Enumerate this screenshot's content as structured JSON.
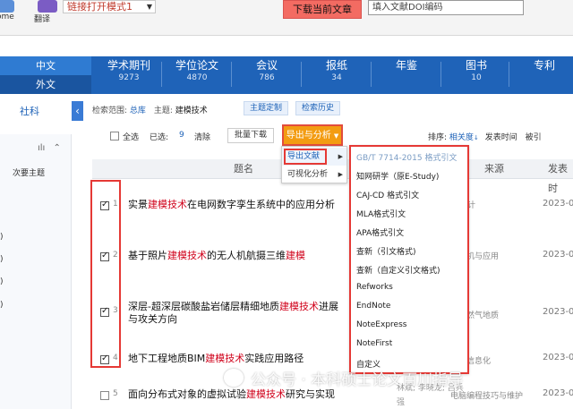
{
  "toolbar": {
    "buttons": [
      {
        "label": "ome",
        "icon": "home-icon"
      },
      {
        "label": "翻译",
        "icon": "translate-icon"
      }
    ],
    "link_mode": "链接打开模式1",
    "download_label": "下载当前文章",
    "doi_placeholder": "填入文献DOI编码"
  },
  "categories": {
    "languages": [
      "中文",
      "外文"
    ],
    "items": [
      {
        "name": "学术期刊",
        "count": "9273"
      },
      {
        "name": "学位论文",
        "count": "4870"
      },
      {
        "name": "会议",
        "count": "786"
      },
      {
        "name": "报纸",
        "count": "34"
      },
      {
        "name": "年鉴",
        "count": ""
      },
      {
        "name": "图书",
        "count": "10"
      },
      {
        "name": "专利",
        "count": ""
      }
    ]
  },
  "sidebar": {
    "tab": "社科",
    "secondary_topic": "次要主题",
    "marks": [
      ")",
      ")",
      ")",
      ")"
    ]
  },
  "search_meta": {
    "scope_label": "检索范围:",
    "scope": "总库",
    "topic_label": "主题:",
    "topic": "建模技术",
    "custom_label": "主题定制",
    "history_label": "检索历史"
  },
  "list_toolbar": {
    "select_all": "全选",
    "selected_label": "已选:",
    "selected_count": "9",
    "clear": "清除",
    "batch_download": "批量下载",
    "export_analyze": "导出与分析",
    "sort_label": "排序:",
    "sort_options": [
      "相关度",
      "发表时间",
      "被引"
    ]
  },
  "table": {
    "headers": [
      "题名",
      "来源",
      "发表时"
    ],
    "rows": [
      {
        "num": "1",
        "checked": true,
        "title_pre": "实景",
        "title_hl": "建模技术",
        "title_post": "在电网数字孪生系统中的应用分析",
        "source": "测设计",
        "date": "2023-0"
      },
      {
        "num": "2",
        "checked": true,
        "title_pre": "基于照片",
        "title_hl": "建模技术",
        "title_post": "的无人机航摄三维",
        "title_hl2": "建模",
        "source": "计算机与应用",
        "date": "2023-0"
      },
      {
        "num": "3",
        "checked": true,
        "title_pre": "深层-超深层碳酸盐岩储层精细地质",
        "title_hl": "建模技术",
        "title_post": "进展与攻关方向",
        "source": "与天然气地质",
        "date": "2023-0"
      },
      {
        "num": "4",
        "checked": true,
        "title_pre": "地下工程地质BIM",
        "title_hl": "建模技术",
        "title_post": "实践应用路径",
        "source": "建设信息化",
        "date": "2023-0"
      },
      {
        "num": "5",
        "checked": false,
        "title_pre": "面向分布式对象的虚拟试验",
        "title_hl": "建模技术",
        "title_post": "研究与实现",
        "source": "电脑编程技巧与维护",
        "authors": "林斌; 李晓龙; 吕兵",
        "author_extra": "强",
        "date": "2023-0"
      }
    ]
  },
  "export_menu": {
    "items": [
      "导出文献",
      "可视化分析"
    ]
  },
  "cite_menu": {
    "items": [
      "GB/T 7714-2015 格式引文",
      "知网研学（原E-Study)",
      "CAJ-CD 格式引文",
      "MLA格式引文",
      "APA格式引文",
      "查新（引文格式)",
      "查新（自定义引文格式)",
      "Refworks",
      "EndNote",
      "NoteExpress",
      "NoteFirst",
      "自定义"
    ]
  },
  "watermark": "公众号 · 本科硕士论文百川指导",
  "colors": {
    "brand": "#1f63b8",
    "highlight": "#d0021b",
    "outline": "#e53935",
    "export": "#f39c12"
  }
}
